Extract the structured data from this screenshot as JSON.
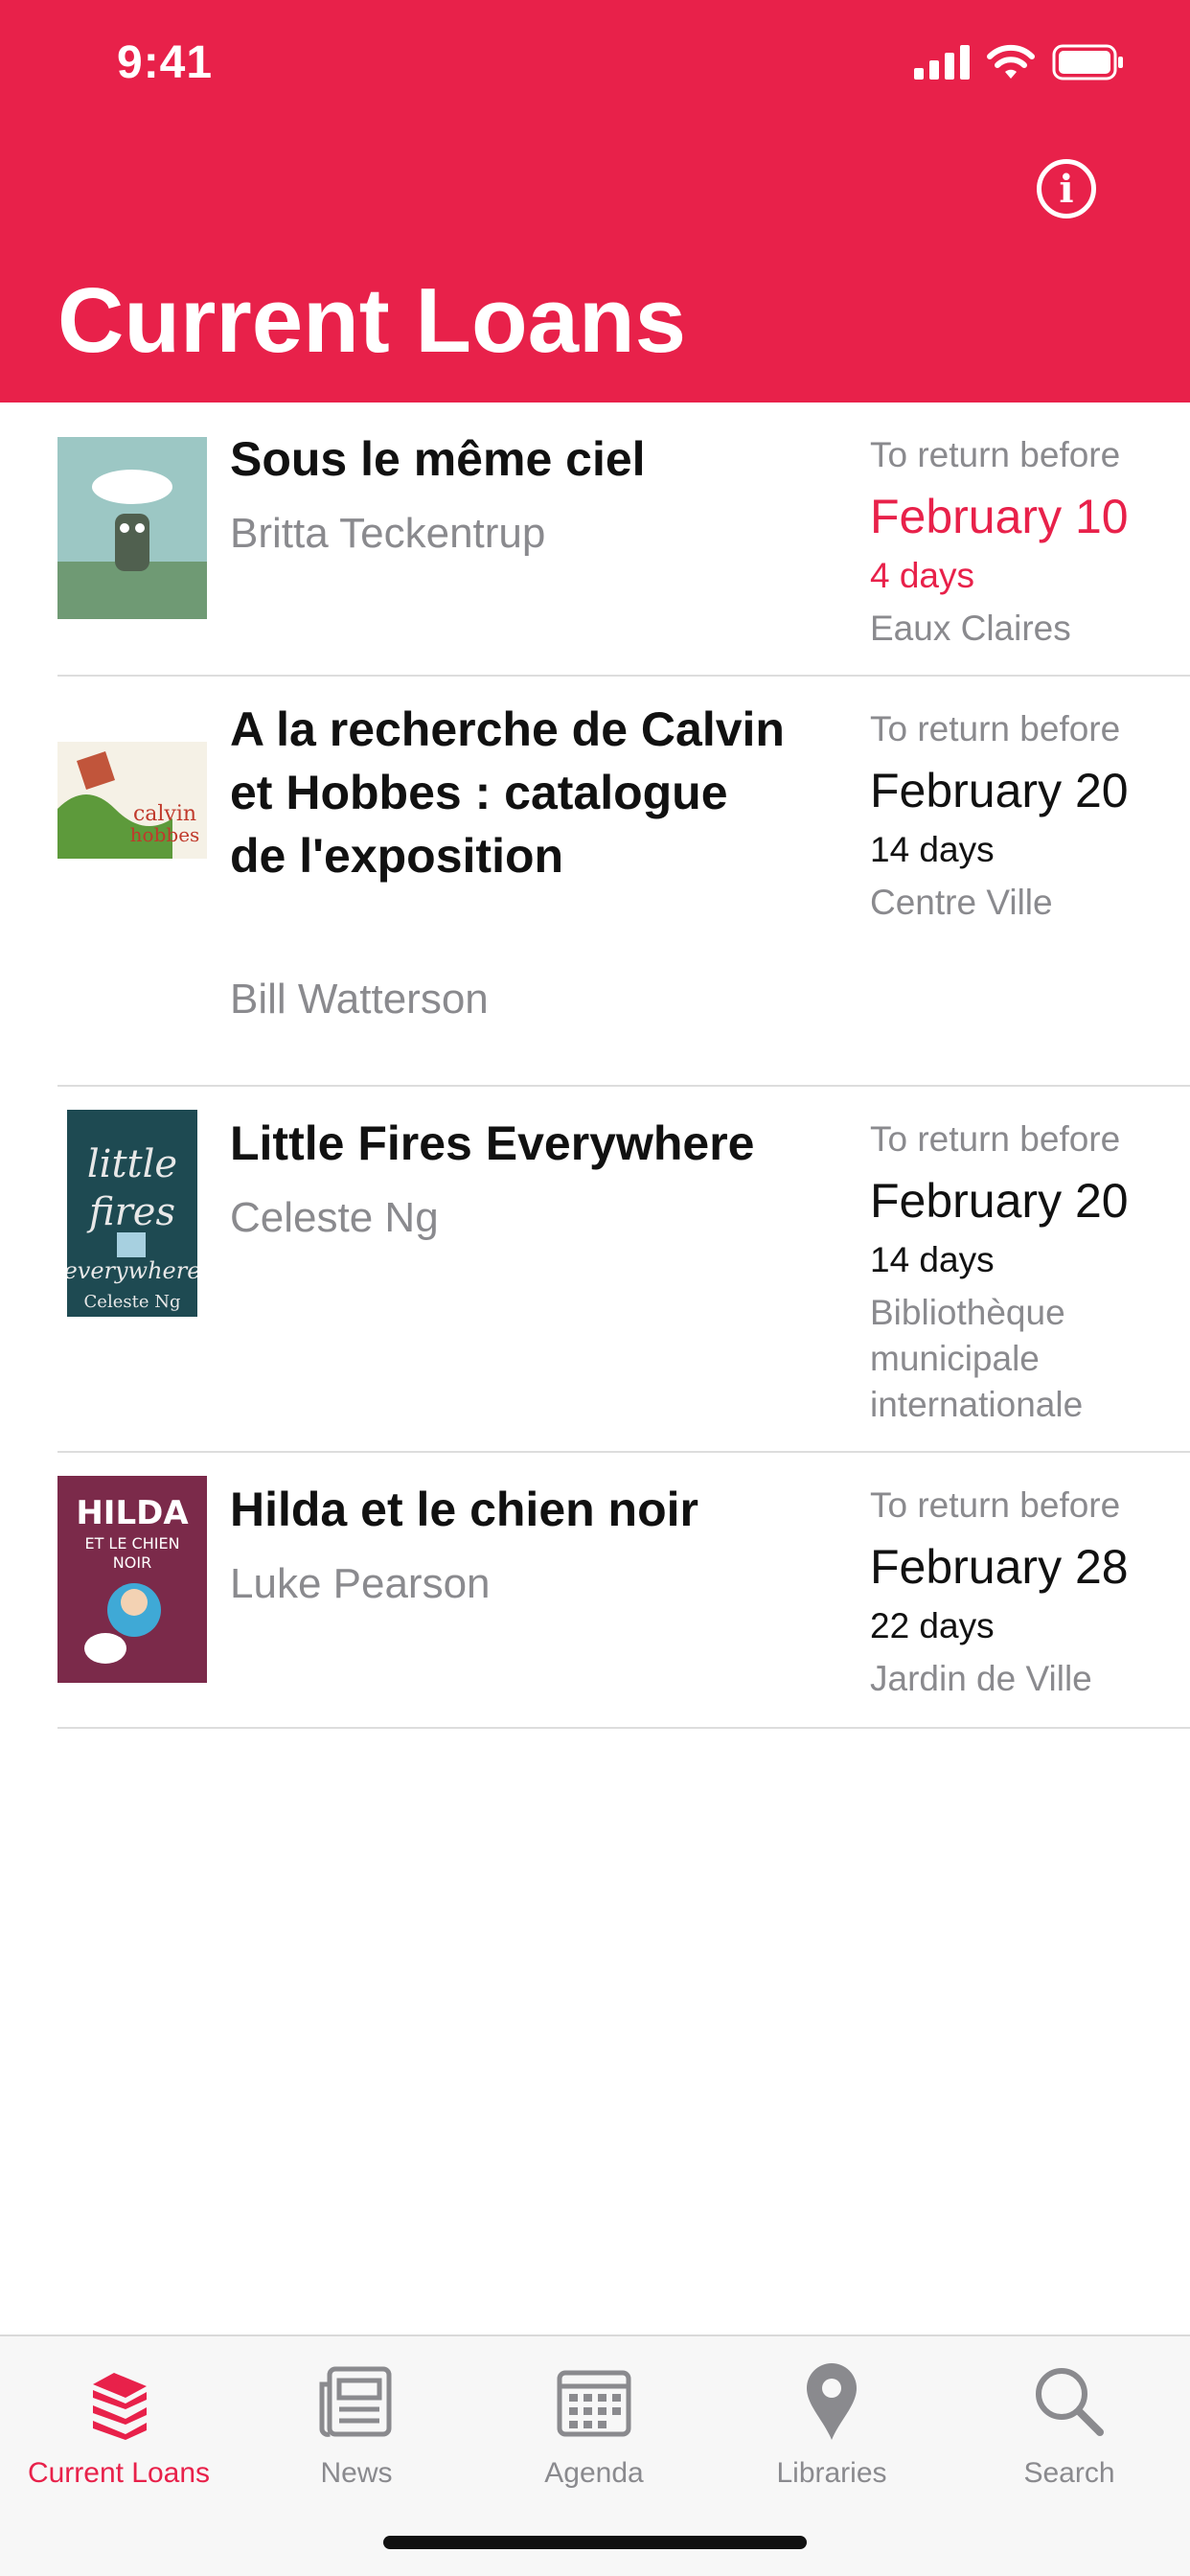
{
  "status": {
    "time": "9:41"
  },
  "header": {
    "title": "Current Loans",
    "info_icon": "info-icon"
  },
  "loans": [
    {
      "title": "Sous le même ciel",
      "author": "Britta Teckentrup",
      "due_caption": "To return before",
      "due_date": "February 10",
      "days_left": "4 days",
      "library": "Eaux Claires",
      "urgent_color": "#E8214A"
    },
    {
      "title": "A la recherche de Calvin et Hobbes : catalogue de l'exposition",
      "author": "Bill Watterson",
      "due_caption": "To return before",
      "due_date": "February 20",
      "days_left": "14 days",
      "library": "Centre Ville"
    },
    {
      "title": "Little Fires Everywhere",
      "author": "Celeste Ng",
      "due_caption": "To return before",
      "due_date": "February 20",
      "days_left": "14 days",
      "library": "Bibliothèque municipale internationale"
    },
    {
      "title": "Hilda et le chien noir",
      "author": "Luke Pearson",
      "due_caption": "To return before",
      "due_date": "February 28",
      "days_left": "22 days",
      "library": "Jardin de Ville"
    }
  ],
  "tabbar": {
    "tabs": [
      {
        "label": "Current Loans",
        "icon": "books-stack-icon",
        "active": true
      },
      {
        "label": "News",
        "icon": "newspaper-icon"
      },
      {
        "label": "Agenda",
        "icon": "calendar-icon"
      },
      {
        "label": "Libraries",
        "icon": "location-pin-icon"
      },
      {
        "label": "Search",
        "icon": "magnifier-icon"
      }
    ]
  },
  "colors": {
    "accent": "#E8214A",
    "secondary_text": "#8a8a8e",
    "divider": "#dddddd"
  }
}
